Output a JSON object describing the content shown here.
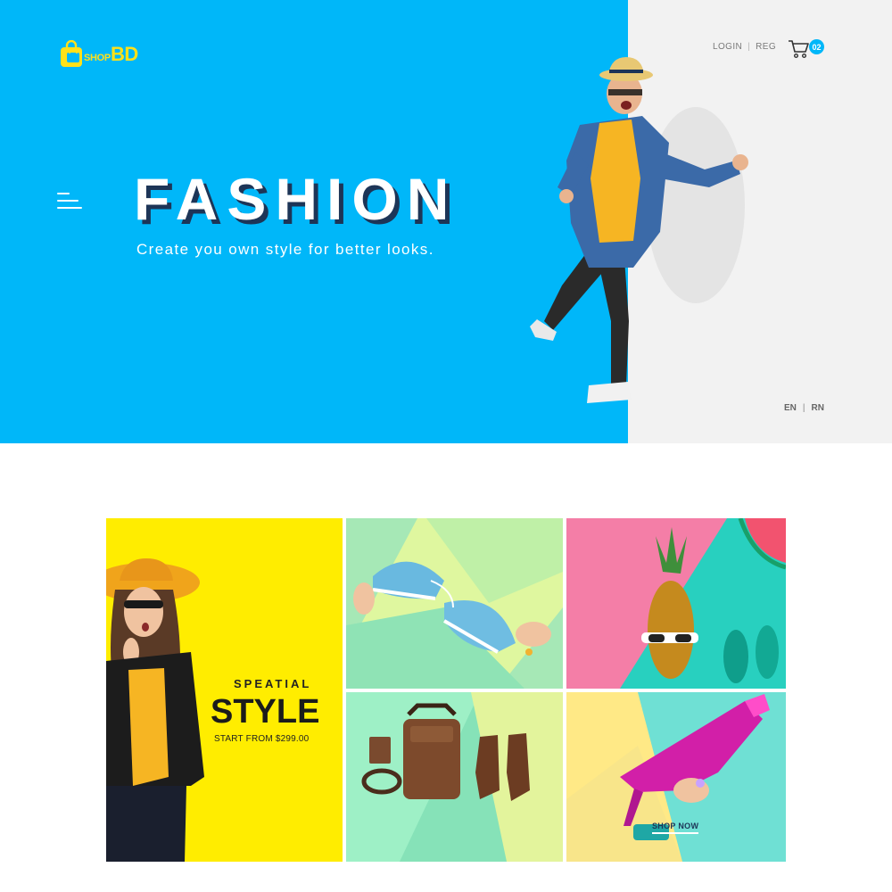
{
  "header": {
    "logo": {
      "shop": "SHOP",
      "bd": "BD"
    },
    "auth": {
      "login": "LOGIN",
      "separator": "|",
      "register": "REG"
    },
    "cart": {
      "count": "02"
    }
  },
  "hero": {
    "title": "FASHION",
    "subtitle": "Create you own style for better looks.",
    "languages": {
      "en": "EN",
      "separator": "|",
      "rn": "RN"
    }
  },
  "promo": {
    "special": {
      "eyebrow": "SPEATIAL",
      "headline": "STYLE",
      "price_text": "START FROM $299.00"
    },
    "shop_now": "SHOP NOW"
  },
  "colors": {
    "hero_blue": "#00b7f9",
    "hero_grey": "#f2f2f2",
    "logo_yellow": "#ffe11a",
    "special_yellow": "#ffed00",
    "badge_blue": "#00b7f9"
  },
  "icons": [
    "shopping-bag-icon",
    "menu-icon",
    "cart-icon"
  ]
}
